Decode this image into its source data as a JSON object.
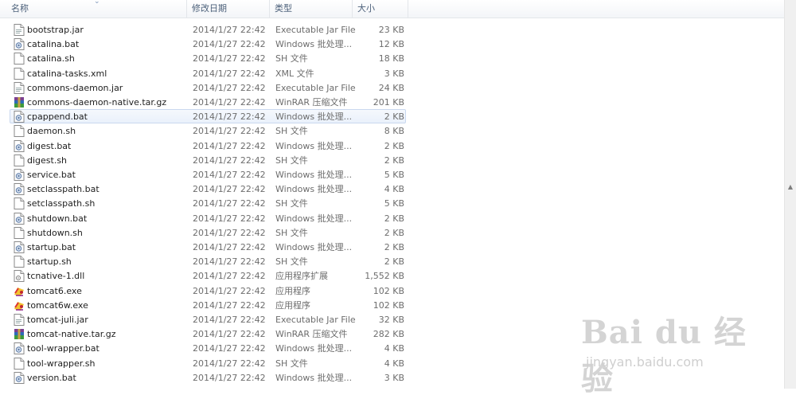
{
  "columns": {
    "name": "名称",
    "date": "修改日期",
    "type": "类型",
    "size": "大小"
  },
  "selected_index": 6,
  "files": [
    {
      "name": "bootstrap.jar",
      "date": "2014/1/27 22:42",
      "type": "Executable Jar File",
      "size": "23 KB",
      "icon": "jar-file-icon"
    },
    {
      "name": "catalina.bat",
      "date": "2014/1/27 22:42",
      "type": "Windows 批处理...",
      "size": "12 KB",
      "icon": "batch-file-icon"
    },
    {
      "name": "catalina.sh",
      "date": "2014/1/27 22:42",
      "type": "SH 文件",
      "size": "18 KB",
      "icon": "blank-file-icon"
    },
    {
      "name": "catalina-tasks.xml",
      "date": "2014/1/27 22:42",
      "type": "XML 文件",
      "size": "3 KB",
      "icon": "blank-file-icon"
    },
    {
      "name": "commons-daemon.jar",
      "date": "2014/1/27 22:42",
      "type": "Executable Jar File",
      "size": "24 KB",
      "icon": "jar-file-icon"
    },
    {
      "name": "commons-daemon-native.tar.gz",
      "date": "2014/1/27 22:42",
      "type": "WinRAR 压缩文件",
      "size": "201 KB",
      "icon": "winrar-archive-icon"
    },
    {
      "name": "cpappend.bat",
      "date": "2014/1/27 22:42",
      "type": "Windows 批处理...",
      "size": "2 KB",
      "icon": "batch-file-icon"
    },
    {
      "name": "daemon.sh",
      "date": "2014/1/27 22:42",
      "type": "SH 文件",
      "size": "8 KB",
      "icon": "blank-file-icon"
    },
    {
      "name": "digest.bat",
      "date": "2014/1/27 22:42",
      "type": "Windows 批处理...",
      "size": "2 KB",
      "icon": "batch-file-icon"
    },
    {
      "name": "digest.sh",
      "date": "2014/1/27 22:42",
      "type": "SH 文件",
      "size": "2 KB",
      "icon": "blank-file-icon"
    },
    {
      "name": "service.bat",
      "date": "2014/1/27 22:42",
      "type": "Windows 批处理...",
      "size": "5 KB",
      "icon": "batch-file-icon"
    },
    {
      "name": "setclasspath.bat",
      "date": "2014/1/27 22:42",
      "type": "Windows 批处理...",
      "size": "4 KB",
      "icon": "batch-file-icon"
    },
    {
      "name": "setclasspath.sh",
      "date": "2014/1/27 22:42",
      "type": "SH 文件",
      "size": "5 KB",
      "icon": "blank-file-icon"
    },
    {
      "name": "shutdown.bat",
      "date": "2014/1/27 22:42",
      "type": "Windows 批处理...",
      "size": "2 KB",
      "icon": "batch-file-icon"
    },
    {
      "name": "shutdown.sh",
      "date": "2014/1/27 22:42",
      "type": "SH 文件",
      "size": "2 KB",
      "icon": "blank-file-icon"
    },
    {
      "name": "startup.bat",
      "date": "2014/1/27 22:42",
      "type": "Windows 批处理...",
      "size": "2 KB",
      "icon": "batch-file-icon"
    },
    {
      "name": "startup.sh",
      "date": "2014/1/27 22:42",
      "type": "SH 文件",
      "size": "2 KB",
      "icon": "blank-file-icon"
    },
    {
      "name": "tcnative-1.dll",
      "date": "2014/1/27 22:42",
      "type": "应用程序扩展",
      "size": "1,552 KB",
      "icon": "dll-file-icon"
    },
    {
      "name": "tomcat6.exe",
      "date": "2014/1/27 22:42",
      "type": "应用程序",
      "size": "102 KB",
      "icon": "tomcat-exe-icon"
    },
    {
      "name": "tomcat6w.exe",
      "date": "2014/1/27 22:42",
      "type": "应用程序",
      "size": "102 KB",
      "icon": "tomcat-exe-icon"
    },
    {
      "name": "tomcat-juli.jar",
      "date": "2014/1/27 22:42",
      "type": "Executable Jar File",
      "size": "32 KB",
      "icon": "jar-file-icon"
    },
    {
      "name": "tomcat-native.tar.gz",
      "date": "2014/1/27 22:42",
      "type": "WinRAR 压缩文件",
      "size": "282 KB",
      "icon": "winrar-archive-icon"
    },
    {
      "name": "tool-wrapper.bat",
      "date": "2014/1/27 22:42",
      "type": "Windows 批处理...",
      "size": "4 KB",
      "icon": "batch-file-icon"
    },
    {
      "name": "tool-wrapper.sh",
      "date": "2014/1/27 22:42",
      "type": "SH 文件",
      "size": "4 KB",
      "icon": "blank-file-icon"
    },
    {
      "name": "version.bat",
      "date": "2014/1/27 22:42",
      "type": "Windows 批处理...",
      "size": "3 KB",
      "icon": "batch-file-icon"
    }
  ],
  "watermark": {
    "brand": "Bai du 经验",
    "url": "jingyan.baidu.com"
  }
}
